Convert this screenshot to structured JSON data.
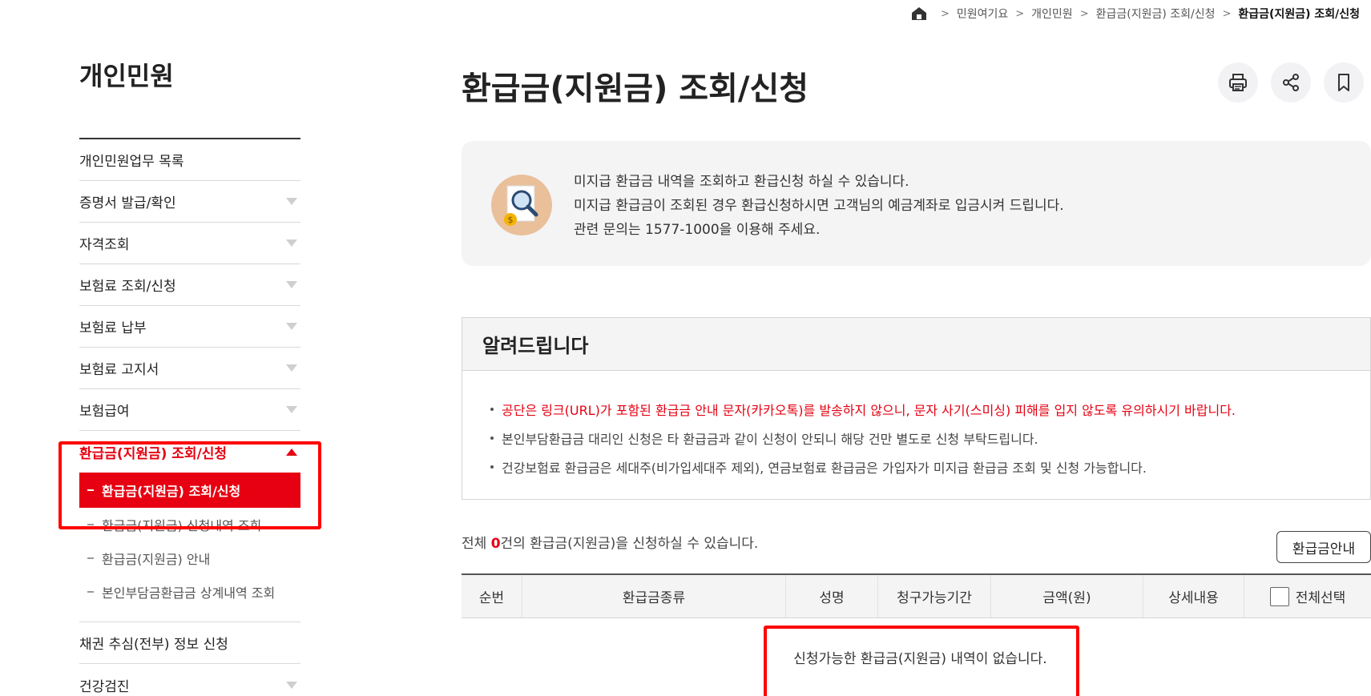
{
  "breadcrumb": {
    "items": [
      "민원여기요",
      "개인민원",
      "환급금(지원금) 조회/신청",
      "환급금(지원금) 조회/신청"
    ]
  },
  "sidebar": {
    "title": "개인민원",
    "items": [
      {
        "label": "개인민원업무 목록"
      },
      {
        "label": "증명서 발급/확인"
      },
      {
        "label": "자격조회"
      },
      {
        "label": "보험료 조회/신청"
      },
      {
        "label": "보험료 납부"
      },
      {
        "label": "보험료 고지서"
      },
      {
        "label": "보험급여"
      },
      {
        "label": "환급금(지원금) 조회/신청"
      },
      {
        "label": "채권 추심(전부) 정보 신청"
      },
      {
        "label": "건강검진"
      }
    ],
    "submenu": [
      {
        "label": "환급금(지원금) 조회/신청"
      },
      {
        "label": "환급금(지원금) 신청내역 조회"
      },
      {
        "label": "환급금(지원금) 안내"
      },
      {
        "label": "본인부담금환급금 상계내역 조회"
      }
    ]
  },
  "main": {
    "title": "환급금(지원금) 조회/신청",
    "toolbar": {
      "print": "print-icon",
      "share": "share-icon",
      "bookmark": "bookmark-icon"
    },
    "info": {
      "lines": [
        "미지급 환급금 내역을 조회하고 환급신청 하실 수 있습니다.",
        "미지급 환급금이 조회된 경우 환급신청하시면 고객님의 예금계좌로 입금시켜 드립니다.",
        "관련 문의는 1577-1000을 이용해 주세요."
      ]
    },
    "notice": {
      "title": "알려드립니다",
      "items": [
        "공단은 링크(URL)가 포함된 환급금 안내 문자(카카오톡)를 발송하지 않으니, 문자 사기(스미싱) 피해를 입지 않도록 유의하시기 바랍니다.",
        "본인부담환급금 대리인 신청은 타 환급금과 같이 신청이 안되니 해당 건만 별도로 신청 부탁드립니다.",
        "건강보험료 환급금은 세대주(비가입세대주 제외), 연금보험료 환급금은 가입자가 미지급 환급금 조회 및 신청 가능합니다."
      ]
    },
    "summary": {
      "prefix": "전체 ",
      "count": "0",
      "suffix": "건의 환급금(지원금)을 신청하실 수 있습니다."
    },
    "guide_button": "환급금안내",
    "table": {
      "headers": [
        "순번",
        "환급금종류",
        "성명",
        "청구가능기간",
        "금액(원)",
        "상세내용",
        "전체선택"
      ],
      "empty": "신청가능한 환급금(지원금) 내역이 없습니다."
    }
  },
  "colors": {
    "accent": "#e60012",
    "highlight": "#ff0000"
  }
}
